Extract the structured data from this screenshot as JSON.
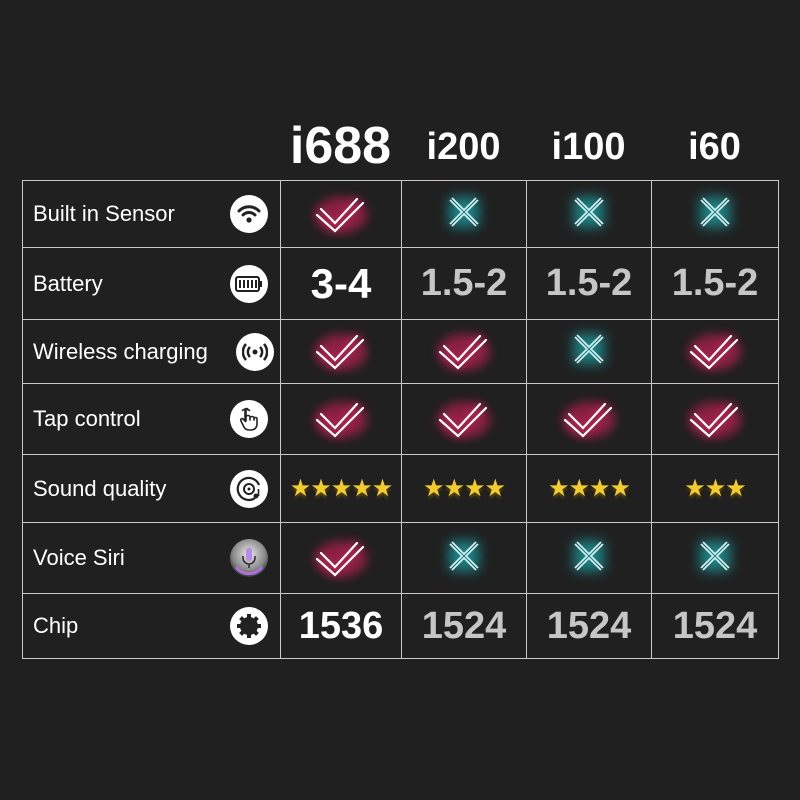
{
  "models": [
    "i688",
    "i200",
    "i100",
    "i60"
  ],
  "colors": {
    "background": "#202020",
    "check": "#e0245e",
    "cross": "#1aa3a8",
    "star": "#f2cc2c"
  },
  "rows": [
    {
      "feature": "Built in Sensor",
      "icon": "wifi-icon",
      "cells": [
        {
          "type": "check"
        },
        {
          "type": "cross"
        },
        {
          "type": "cross"
        },
        {
          "type": "cross"
        }
      ]
    },
    {
      "feature": "Battery",
      "icon": "battery-icon",
      "cells": [
        {
          "type": "text",
          "value": "3-4"
        },
        {
          "type": "text",
          "value": "1.5-2"
        },
        {
          "type": "text",
          "value": "1.5-2"
        },
        {
          "type": "text",
          "value": "1.5-2"
        }
      ]
    },
    {
      "feature": "Wireless charging",
      "icon": "wireless-signal-icon",
      "cells": [
        {
          "type": "check"
        },
        {
          "type": "check"
        },
        {
          "type": "cross"
        },
        {
          "type": "check"
        }
      ]
    },
    {
      "feature": "Tap control",
      "icon": "tap-hand-icon",
      "cells": [
        {
          "type": "check"
        },
        {
          "type": "check"
        },
        {
          "type": "check"
        },
        {
          "type": "check"
        }
      ]
    },
    {
      "feature": "Sound quality",
      "icon": "music-disc-icon",
      "cells": [
        {
          "type": "stars",
          "value": 5
        },
        {
          "type": "stars",
          "value": 4
        },
        {
          "type": "stars",
          "value": 4
        },
        {
          "type": "stars",
          "value": 3
        }
      ]
    },
    {
      "feature": "Voice Siri",
      "icon": "microphone-icon",
      "cells": [
        {
          "type": "check"
        },
        {
          "type": "cross"
        },
        {
          "type": "cross"
        },
        {
          "type": "cross"
        }
      ]
    },
    {
      "feature": "Chip",
      "icon": "chip-icon",
      "cells": [
        {
          "type": "text",
          "value": "1536"
        },
        {
          "type": "text",
          "value": "1524"
        },
        {
          "type": "text",
          "value": "1524"
        },
        {
          "type": "text",
          "value": "1524"
        }
      ]
    }
  ]
}
